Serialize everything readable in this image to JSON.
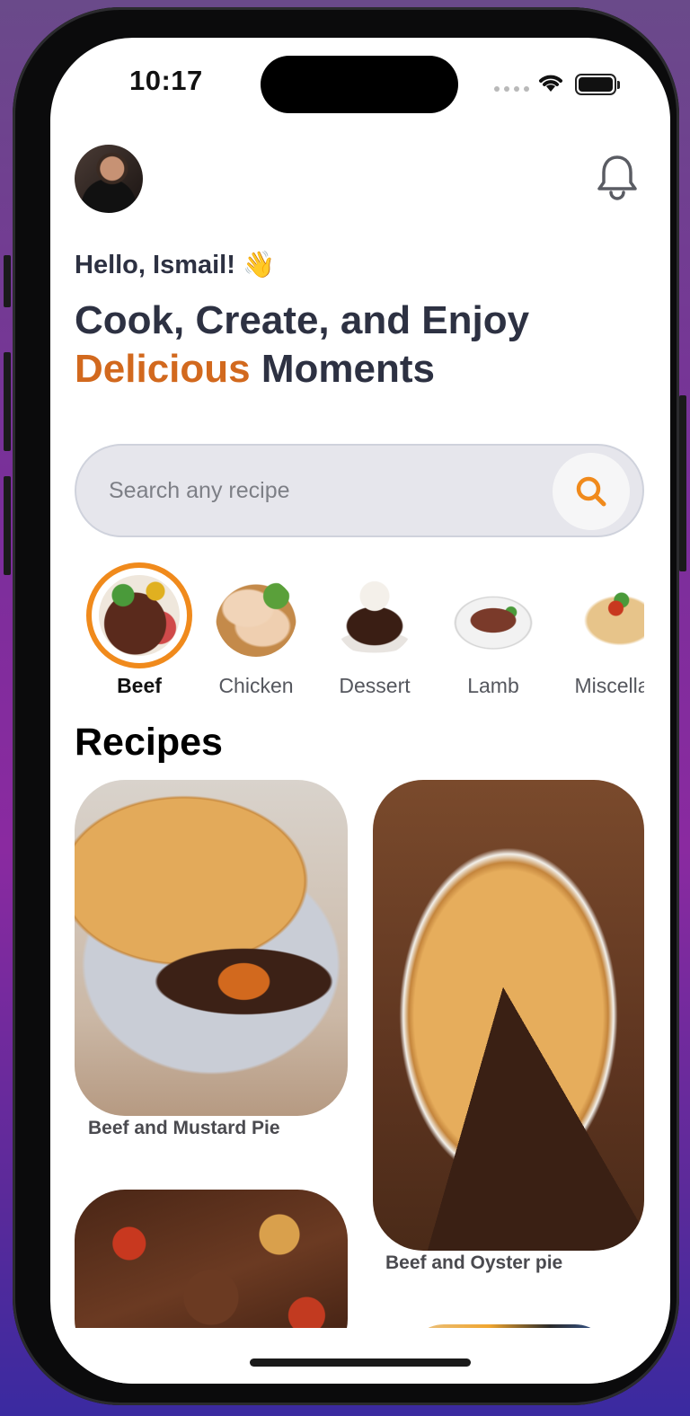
{
  "status_bar": {
    "time": "10:17"
  },
  "header": {
    "avatar_icon": "user-avatar",
    "notification_icon": "bell-icon"
  },
  "greeting": "Hello, Ismail! 👋",
  "headline": {
    "line1": "Cook, Create, and Enjoy",
    "accent": "Delicious",
    "rest": "Moments"
  },
  "search": {
    "placeholder": "Search any recipe",
    "icon": "search-icon"
  },
  "categories": [
    {
      "label": "Beef",
      "active": true
    },
    {
      "label": "Chicken",
      "active": false
    },
    {
      "label": "Dessert",
      "active": false
    },
    {
      "label": "Lamb",
      "active": false
    },
    {
      "label": "Miscella",
      "active": false
    }
  ],
  "recipes_title": "Recipes",
  "recipes": [
    {
      "title": "Beef and Mustard Pie"
    },
    {
      "title": "Beef and Oyster pie"
    }
  ],
  "colors": {
    "accent": "#d2691e",
    "active_ring": "#f08a1c",
    "heading": "#2d3142"
  }
}
